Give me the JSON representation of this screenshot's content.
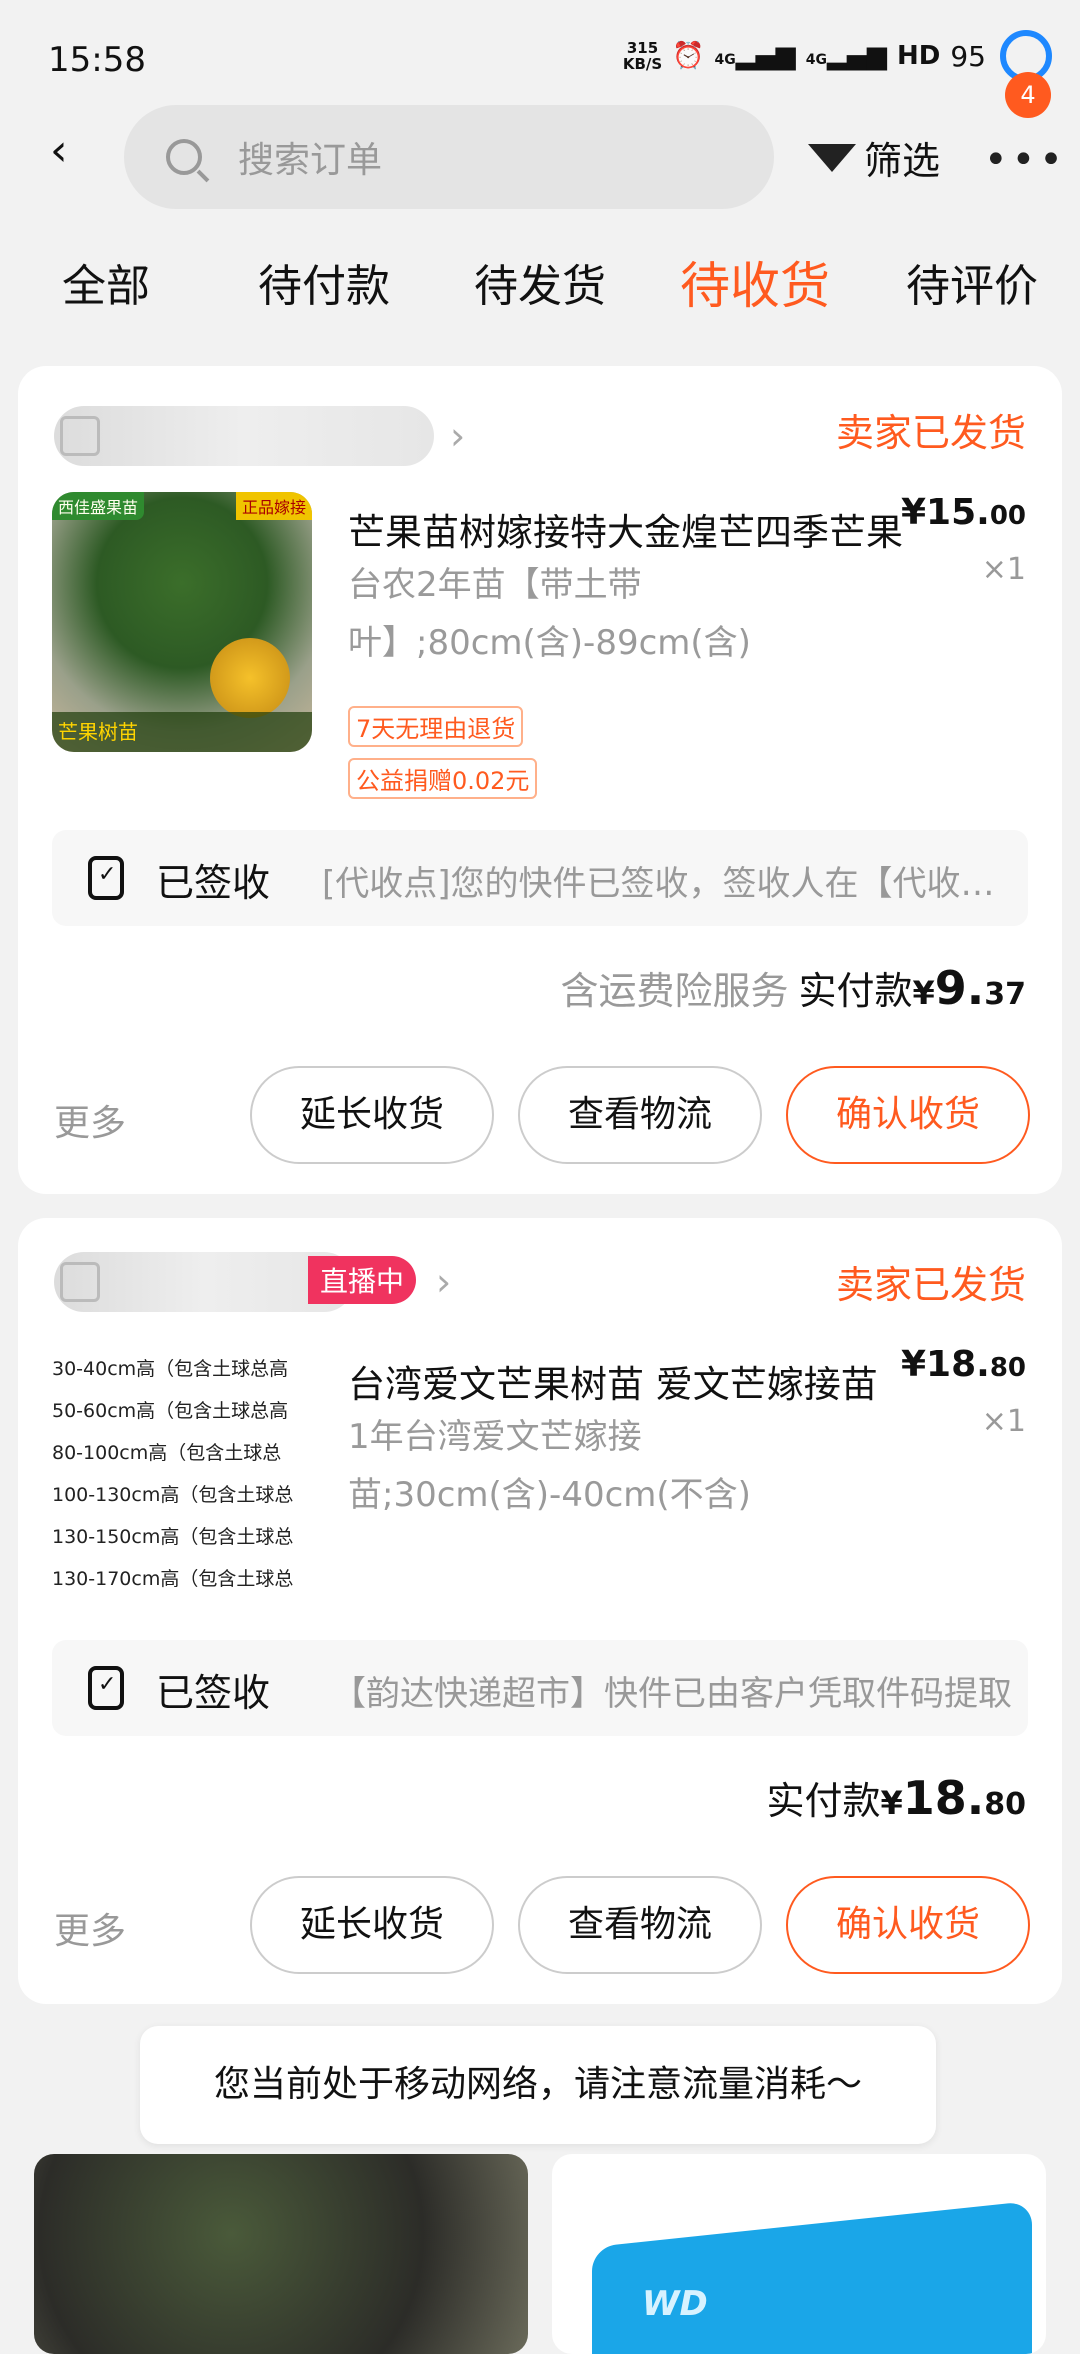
{
  "status_bar": {
    "time": "15:58",
    "speed_value": "315",
    "speed_unit": "KB/S",
    "battery": "95",
    "network": "4G",
    "hd": "HD"
  },
  "header": {
    "search_placeholder": "搜索订单",
    "filter_label": "筛选",
    "more_badge": "4"
  },
  "tabs": [
    {
      "label": "全部",
      "active": false
    },
    {
      "label": "待付款",
      "active": false
    },
    {
      "label": "待发货",
      "active": false
    },
    {
      "label": "待收货",
      "active": true
    },
    {
      "label": "待评价",
      "active": false
    }
  ],
  "orders": [
    {
      "status": "卖家已发货",
      "thumb_tag_left": "西佳盛果苗",
      "thumb_tag_right": "正品嫁接",
      "thumb_caption": "芒果树苗",
      "title": "芒果苗树嫁接特大金煌芒四季芒果",
      "sku": "台农2年苗【带土带叶】;80cm(含)-89cm(含)",
      "price_main": "¥15.",
      "price_cents": "00",
      "qty": "×1",
      "badges": [
        "7天无理由退货",
        "公益捐赠0.02元"
      ],
      "logistics_status": "已签收",
      "logistics_msg": "[代收点]您的快件已签收，签收人在【代收点】",
      "insurance": "含运费险服务",
      "pay_label": "实付款",
      "pay_yen": "¥",
      "pay_main": "9.",
      "pay_cents": "37",
      "more": "更多",
      "btn_extend": "延长收货",
      "btn_logistics": "查看物流",
      "btn_confirm": "确认收货"
    },
    {
      "status": "卖家已发货",
      "live": "直播中",
      "thumb_lines": [
        "30-40cm高（包含土球总高",
        "50-60cm高（包含土球总高",
        "80-100cm高（包含土球总",
        "100-130cm高（包含土球总",
        "130-150cm高（包含土球总",
        "130-170cm高（包含土球总"
      ],
      "title": "台湾爱文芒果树苗 爱文芒嫁接苗",
      "sku": "1年台湾爱文芒嫁接苗;30cm(含)-40cm(不含)",
      "price_main": "¥18.",
      "price_cents": "80",
      "qty": "×1",
      "logistics_status": "已签收",
      "logistics_msg": "【韵达快递超市】快件已由客户凭取件码提取",
      "pay_label": "实付款",
      "pay_yen": "¥",
      "pay_main": "18.",
      "pay_cents": "80",
      "more": "更多",
      "btn_extend": "延长收货",
      "btn_logistics": "查看物流",
      "btn_confirm": "确认收货"
    }
  ],
  "toast": "您当前处于移动网络，请注意流量消耗～",
  "recommend": [
    {
      "name": "jaboticaba-tree-photo"
    },
    {
      "name": "wd-hard-drive-photo",
      "logo": "WD"
    }
  ]
}
